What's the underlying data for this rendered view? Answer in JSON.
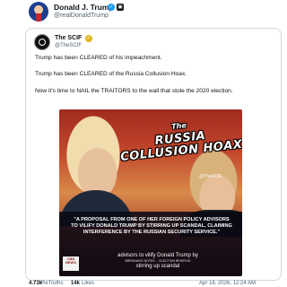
{
  "post": {
    "author_name": "Donald J. Trump",
    "author_handle": "@realDonaldTrump",
    "affiliation_badge": "▣",
    "retweets_count": "4.73k",
    "retweets_label": "ReTruths",
    "likes_count": "14k",
    "likes_label": "Likes",
    "timestamp": "Apr 18, 2026, 12:24 AM"
  },
  "quoted": {
    "name": "The SCIF",
    "handle": "@TheSCIF",
    "lines": [
      "Trump has been CLEARED of his impeachment.",
      "Trump has been CLEARED of the Russia Collusion Hoax.",
      "Now it's time to NAIL the TRAITORS to the wall that stole the 2020 election."
    ]
  },
  "media": {
    "title_small": "The",
    "title_line1": "RUSSIA",
    "title_line2": "COLLUSION HOAX",
    "credit": "@TheSCIF",
    "caption": "\"A PROPOSAL FROM ONE OF HER FOREIGN POLICY ADVISORS TO VILIFY DONALD TRUMP BY STIRRING UP SCANDAL, CLAIMING INTERFERENCE BY THE RUSSIAN SECURITY SERVICE.\"",
    "live_caption_1": "advisors to vilify Donald Trump by",
    "live_small": "BRENNAN'S NOTES ... ELECTION BRIEFING",
    "live_caption_2": "stirring up scandal",
    "news_logo": "CBN NEWS"
  },
  "colors": {
    "verified_blue": "#1d9bf0",
    "verified_gold": "#e2b719",
    "secondary_text": "#536471",
    "border": "#cfd9de"
  }
}
